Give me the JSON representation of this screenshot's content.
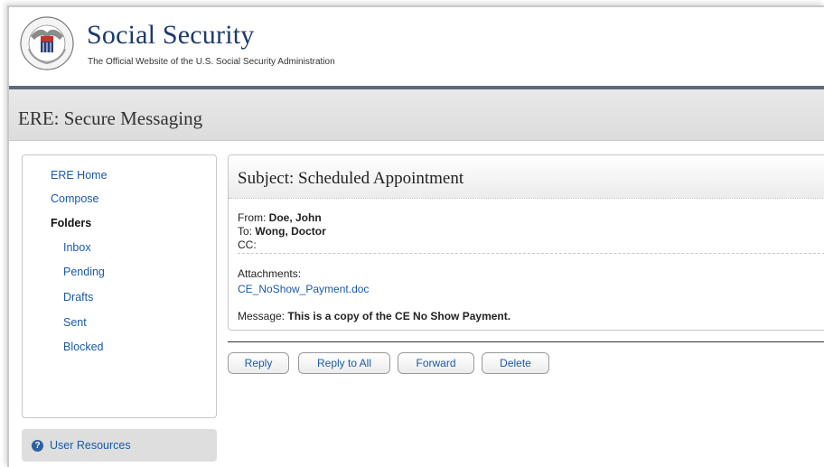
{
  "header": {
    "title": "Social Security",
    "subtitle": "The Official Website of the U.S. Social Security Administration",
    "seal_icon": "ssa-seal-icon"
  },
  "page": {
    "title": "ERE: Secure Messaging"
  },
  "nav": {
    "ere_home": "ERE Home",
    "compose": "Compose",
    "folders": "Folders",
    "inbox": "Inbox",
    "pending": "Pending",
    "drafts": "Drafts",
    "sent": "Sent",
    "blocked": "Blocked"
  },
  "resources": {
    "label": "User Resources",
    "icon": "help-icon"
  },
  "message": {
    "subject": "Subject: Scheduled Appointment",
    "from_label": "From: ",
    "from_value": "Doe, John",
    "to_label": "To: ",
    "to_value": "Wong, Doctor",
    "cc_label": "CC:",
    "attachments_label": "Attachments:",
    "attachment_file": "CE_NoShow_Payment.doc",
    "message_label": "Message: ",
    "message_value": "This is a copy of the CE No Show Payment."
  },
  "actions": {
    "reply": "Reply",
    "reply_all": "Reply to All",
    "forward": "Forward",
    "delete": "Delete"
  },
  "colors": {
    "brand_navy": "#1d3a6b",
    "link_blue": "#1a5aa6",
    "header_bar": "#5e6a7a"
  }
}
